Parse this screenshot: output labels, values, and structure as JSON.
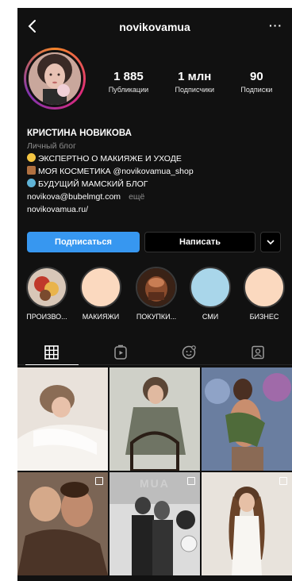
{
  "header": {
    "username": "novikovamua",
    "back_icon": "chevron-left-icon",
    "more_label": "···"
  },
  "profile": {
    "stats": [
      {
        "value": "1 885",
        "label": "Публикации"
      },
      {
        "value": "1 млн",
        "label": "Подписчики"
      },
      {
        "value": "90",
        "label": "Подписки"
      }
    ]
  },
  "bio": {
    "name": "КРИСТИНА НОВИКОВА",
    "category": "Личный блог",
    "lines": [
      "ЭКСПЕРТНО О МАКИЯЖЕ И УХОДЕ",
      "МОЯ КОСМЕТИКА @novikovamua_shop",
      "БУДУЩИЙ МАМСКИЙ БЛОГ"
    ],
    "email": "novikova@bubelmgt.com",
    "more": "ещё",
    "website": "novikovamua.ru/"
  },
  "actions": {
    "follow": "Подписаться",
    "message": "Написать",
    "dropdown": "⌄"
  },
  "highlights": [
    {
      "label": "ПРОИЗВО..."
    },
    {
      "label": "МАКИЯЖИ"
    },
    {
      "label": "ПОКУПКИ..."
    },
    {
      "label": "СМИ"
    },
    {
      "label": "БИЗНЕС"
    }
  ],
  "tabs": [
    "grid-icon",
    "reels-icon",
    "guides-icon",
    "tagged-icon"
  ],
  "colors": {
    "background": "#111111",
    "accent": "#3797f0"
  },
  "grid_watermark": "MUA"
}
